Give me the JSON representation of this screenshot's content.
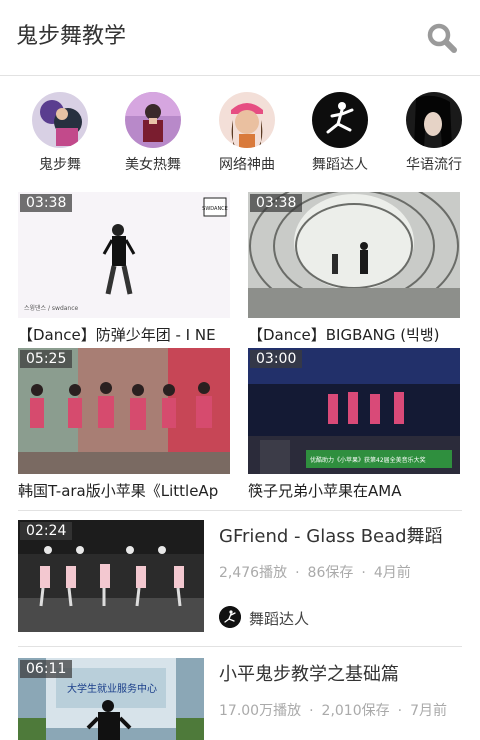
{
  "header": {
    "title": "鬼步舞教学",
    "search_icon": "search-icon"
  },
  "categories": [
    {
      "label": "鬼步舞",
      "icon": "avatar-ghost-step"
    },
    {
      "label": "美女热舞",
      "icon": "avatar-hot-dance"
    },
    {
      "label": "网络神曲",
      "icon": "avatar-web-song"
    },
    {
      "label": "舞蹈达人",
      "icon": "avatar-dance-master"
    },
    {
      "label": "华语流行",
      "icon": "avatar-chinese-pop"
    }
  ],
  "grid_videos": [
    {
      "duration": "03:38",
      "title": "【Dance】防弹少年团 - I NE"
    },
    {
      "duration": "03:38",
      "title": "【Dance】BIGBANG (빅뱅)"
    },
    {
      "duration": "05:25",
      "title": "韩国T-ara版小苹果《LittleAp"
    },
    {
      "duration": "03:00",
      "title": "筷子兄弟小苹果在AMA"
    }
  ],
  "list_videos": [
    {
      "duration": "02:24",
      "title": "GFriend - Glass Bead舞蹈",
      "plays": "2,476播放",
      "saves": "86保存",
      "date": "4月前",
      "channel": "舞蹈达人"
    },
    {
      "duration": "06:11",
      "title": "小平鬼步教学之基础篇",
      "plays": "17.00万播放",
      "saves": "2,010保存",
      "date": "7月前"
    }
  ],
  "meta_separator": "·",
  "thumb_texts": {
    "g0_badge": "SWDANCE",
    "g0_caption": "스윙댄스 / swdance",
    "g3_banner": "优酷助力《小苹果》获第42届全美音乐大奖",
    "l1_banner": "大学生就业服务中心"
  },
  "colors": {
    "accent": "#999999",
    "meta": "#aaaaaa",
    "divider": "#e2e2e2"
  }
}
